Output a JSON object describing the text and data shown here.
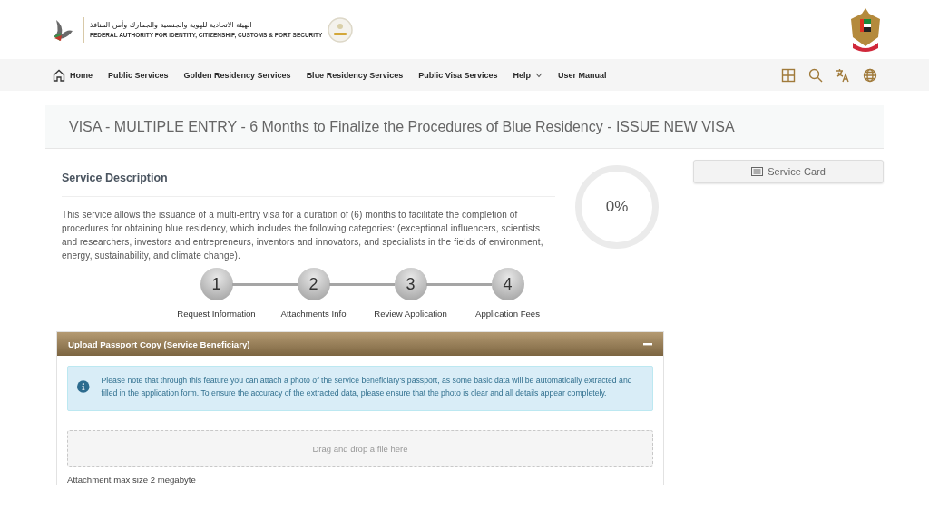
{
  "header": {
    "logo_arabic": "الهيئة الاتحادية للهوية والجنسية والجمارك وأمن المنافذ",
    "logo_english": "FEDERAL AUTHORITY FOR IDENTITY, CITIZENSHIP, CUSTOMS & PORT SECURITY"
  },
  "nav": [
    {
      "label": "Home",
      "kind": "home"
    },
    {
      "label": "Public Services",
      "kind": "link"
    },
    {
      "label": "Golden Residency Services",
      "kind": "link"
    },
    {
      "label": "Blue Residency Services",
      "kind": "link"
    },
    {
      "label": "Public Visa Services",
      "kind": "link"
    },
    {
      "label": "Help",
      "kind": "dropdown"
    },
    {
      "label": "User Manual",
      "kind": "link"
    }
  ],
  "page_title": "VISA - MULTIPLE ENTRY - 6 Months to Finalize the Procedures of Blue Residency - ISSUE NEW VISA",
  "description": {
    "heading": "Service Description",
    "text": "This service allows the issuance of a multi-entry visa for a duration of (6) months to facilitate the completion of procedures for obtaining blue residency, which includes the following categories: (exceptional influencers, scientists and researchers, investors and entrepreneurs, inventors and innovators, and specialists in the fields of environment, energy, sustainability, and climate change)."
  },
  "progress": {
    "reading": "0%"
  },
  "steps": [
    {
      "number": "1",
      "label": "Request Information"
    },
    {
      "number": "2",
      "label": "Attachments Info"
    },
    {
      "number": "3",
      "label": "Review Application"
    },
    {
      "number": "4",
      "label": "Application Fees"
    }
  ],
  "service_card_button": "Service Card",
  "panel": {
    "title": "Upload Passport Copy (Service Beneficiary)",
    "expanded": true,
    "notice": "Please note that through this feature you can attach a photo of the service beneficiary's passport, as some basic data will be automatically extracted and filled in the application form. To ensure the accuracy of the extracted data, please ensure that the photo is clear and all details appear completely.",
    "dropzone": "Drag and drop a file here",
    "note": "Attachment max size 2 megabyte"
  }
}
